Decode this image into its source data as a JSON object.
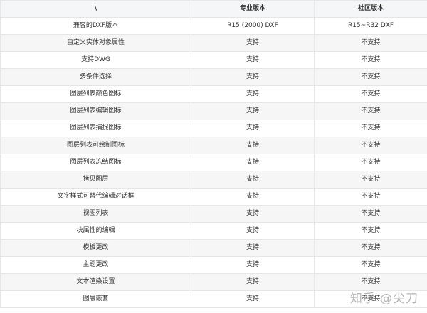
{
  "table": {
    "headers": [
      "\\",
      "专业版本",
      "社区版本"
    ],
    "rows": [
      [
        "兼容的DXF版本",
        "R15 (2000) DXF",
        "R15~R32 DXF"
      ],
      [
        "自定义实体对象属性",
        "支持",
        "不支持"
      ],
      [
        "支持DWG",
        "支持",
        "不支持"
      ],
      [
        "多条件选择",
        "支持",
        "不支持"
      ],
      [
        "图层列表颜色图标",
        "支持",
        "不支持"
      ],
      [
        "图层列表编辑图标",
        "支持",
        "不支持"
      ],
      [
        "图层列表捕捉图标",
        "支持",
        "不支持"
      ],
      [
        "图层列表可绘制图标",
        "支持",
        "不支持"
      ],
      [
        "图层列表冻结图标",
        "支持",
        "不支持"
      ],
      [
        "拷贝图层",
        "支持",
        "不支持"
      ],
      [
        "文字样式可替代编辑对话框",
        "支持",
        "不支持"
      ],
      [
        "视图列表",
        "支持",
        "不支持"
      ],
      [
        "块属性的编辑",
        "支持",
        "不支持"
      ],
      [
        "模板更改",
        "支持",
        "不支持"
      ],
      [
        "主题更改",
        "支持",
        "不支持"
      ],
      [
        "文本渲染设置",
        "支持",
        "不支持"
      ],
      [
        "图层嵌套",
        "支持",
        "不支持"
      ]
    ]
  },
  "watermark": {
    "brand": "知乎",
    "handle": "@尖刀"
  }
}
